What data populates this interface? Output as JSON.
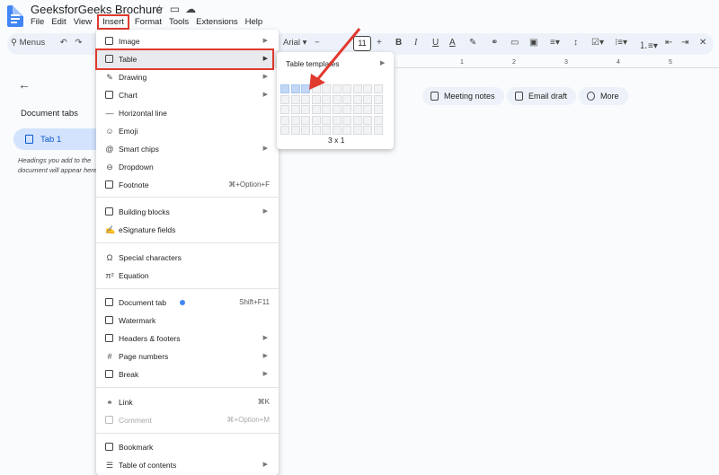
{
  "title": "GeeksforGeeks Brochure",
  "menubar": [
    "File",
    "Edit",
    "View",
    "Insert",
    "Format",
    "Tools",
    "Extensions",
    "Help"
  ],
  "toolbar": {
    "search": "Menus",
    "font": "Arial",
    "size": "11"
  },
  "ruler": [
    "1",
    "2",
    "3",
    "4",
    "5"
  ],
  "panel": {
    "title": "Document tabs",
    "tab": "Tab 1",
    "hint": "Headings you add to the document will appear here."
  },
  "chips": [
    "Meeting notes",
    "Email draft",
    "More"
  ],
  "menu": {
    "image": "Image",
    "table": "Table",
    "drawing": "Drawing",
    "chart": "Chart",
    "hline": "Horizontal line",
    "emoji": "Emoji",
    "smart_chips": "Smart chips",
    "dropdown": "Dropdown",
    "footnote": "Footnote",
    "footnote_sc": "⌘+Option+F",
    "building_blocks": "Building blocks",
    "esignature": "eSignature fields",
    "special_chars": "Special characters",
    "equation": "Equation",
    "doc_tab": "Document tab",
    "doc_tab_sc": "Shift+F11",
    "watermark": "Watermark",
    "headers_footers": "Headers & footers",
    "page_numbers": "Page numbers",
    "break": "Break",
    "link": "Link",
    "link_sc": "⌘K",
    "comment": "Comment",
    "comment_sc": "⌘+Option+M",
    "bookmark": "Bookmark",
    "toc": "Table of contents"
  },
  "submenu": {
    "templates": "Table templates",
    "dimension": "3 x 1",
    "cols": 10,
    "rows": 5,
    "selected_cols": 3,
    "selected_rows": 1
  },
  "colors": {
    "highlight": "#e03a2e",
    "accent": "#0b57d0"
  }
}
